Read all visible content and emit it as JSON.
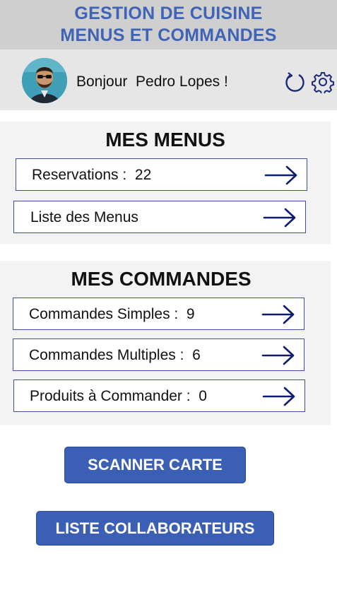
{
  "header": {
    "title_line1": "GESTION DE CUISINE",
    "title_line2": "MENUS ET COMMANDES"
  },
  "user": {
    "greeting": "Bonjour  Pedro Lopes !",
    "avatar_alt": "Pedro Lopes"
  },
  "icons": {
    "refresh": "refresh-icon",
    "settings": "gear-icon",
    "row_arrow": "arrow-right-icon"
  },
  "menus": {
    "title": "MES MENUS",
    "items": [
      {
        "label": "Reservations :  22"
      },
      {
        "label": "Liste des Menus"
      }
    ]
  },
  "commandes": {
    "title": "MES COMMANDES",
    "items": [
      {
        "label": "Commandes Simples :  9"
      },
      {
        "label": "Commandes Multiples :  6"
      },
      {
        "label": "Produits à Commander :  0"
      }
    ]
  },
  "buttons": {
    "scanner": "SCANNER CARTE",
    "collaborateurs": "LISTE COLLABORATEURS"
  },
  "colors": {
    "accent": "#3f63b5",
    "button": "#3a5fb5",
    "arrow": "#0d1b6e",
    "header_bg": "#cfcfcf",
    "panel_bg": "#f3f3f3"
  }
}
